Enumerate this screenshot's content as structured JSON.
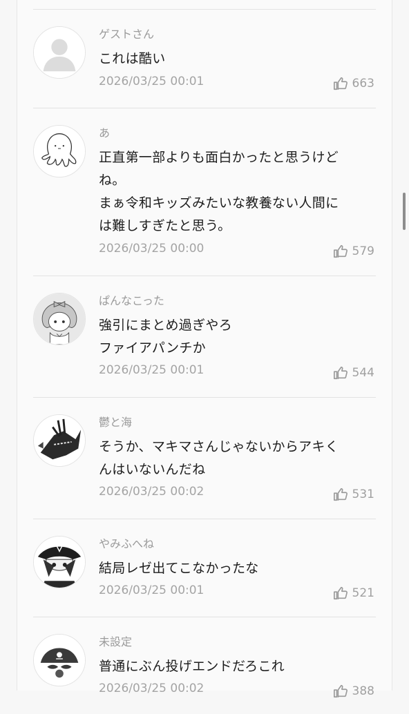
{
  "comments": [
    {
      "author": "ゲストさん",
      "lines": [
        "これは酷い"
      ],
      "date": "2026/03/25 00:01",
      "likes": "663",
      "avatar_icon": "default-person-icon"
    },
    {
      "author": "あ",
      "lines": [
        "正直第一部よりも面白かったと思うけど",
        "ね。",
        "まぁ令和キッズみたいな教養ない人間に",
        "は難しすぎたと思う。"
      ],
      "date": "2026/03/25 00:00",
      "likes": "579",
      "avatar_icon": "octopus-avatar-icon"
    },
    {
      "author": "ぱんなこった",
      "lines": [
        "強引にまとめ過ぎやろ",
        "ファイアパンチか"
      ],
      "date": "2026/03/25 00:01",
      "likes": "544",
      "avatar_icon": "girl-with-bow-avatar-icon"
    },
    {
      "author": "鬱と海",
      "lines": [
        "そうか、マキマさんじゃないからアキく",
        "んはいないんだね"
      ],
      "date": "2026/03/25 00:02",
      "likes": "531",
      "avatar_icon": "chainsaw-character-avatar-icon"
    },
    {
      "author": "やみふへね",
      "lines": [
        "結局レゼ出てこなかったな"
      ],
      "date": "2026/03/25 00:01",
      "likes": "521",
      "avatar_icon": "pirate-girl-avatar-icon"
    },
    {
      "author": "未設定",
      "lines": [
        "普通にぶん投げエンドだろこれ"
      ],
      "date": "2026/03/25 00:02",
      "likes": "388",
      "avatar_icon": "pirate-skull-avatar-icon"
    }
  ]
}
